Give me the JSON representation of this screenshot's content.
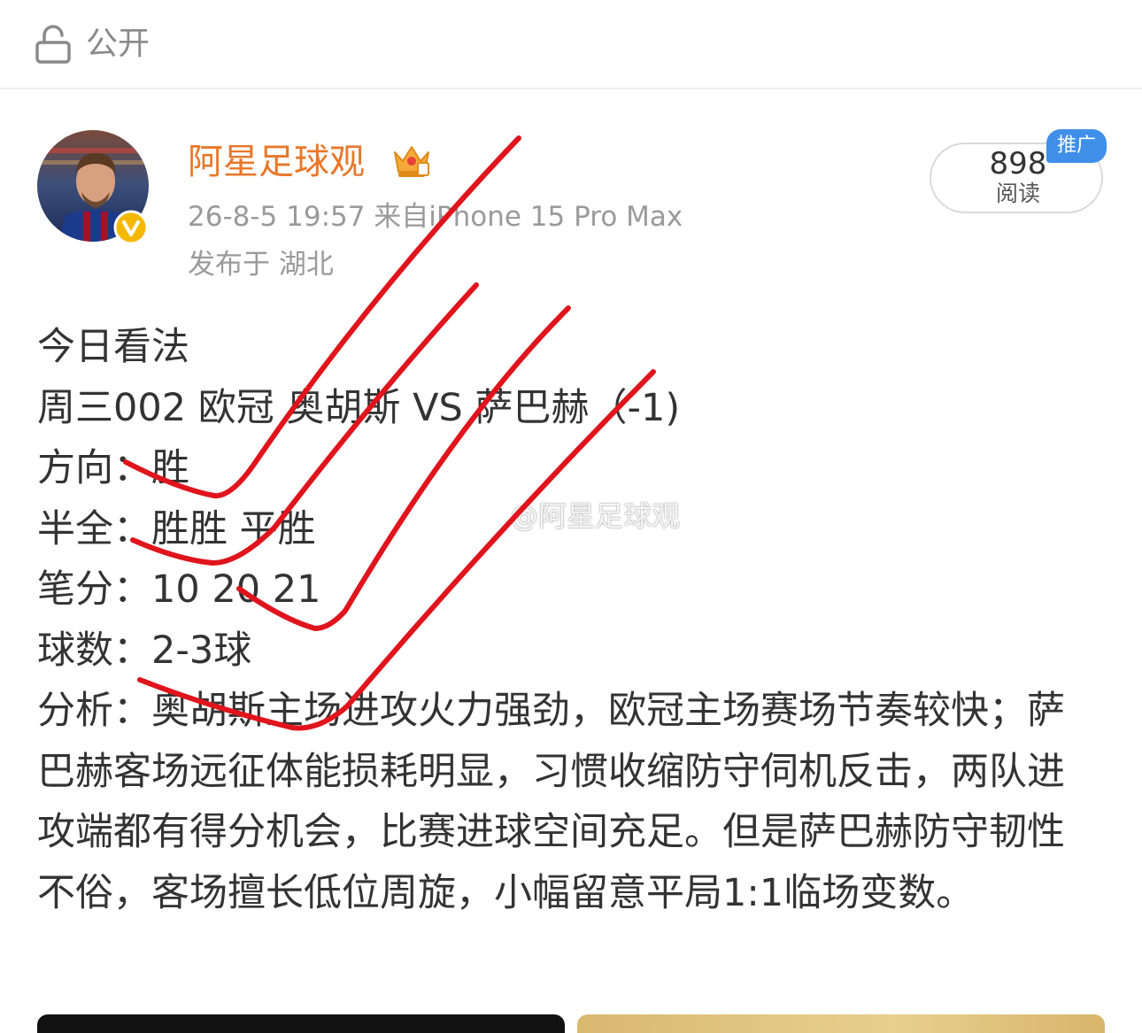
{
  "topbar": {
    "visibility_label": "公开",
    "icon": "lock-icon"
  },
  "post": {
    "author": {
      "name": "阿星足球观",
      "avatar_icon": "avatar",
      "badge_icon": "crown-icon",
      "verified_icon": "verified-badge"
    },
    "meta": "26-8-5 19:57  来自iPhone 15 Pro Max",
    "location": "发布于 湖北",
    "reads": {
      "count": "898",
      "label": "阅读",
      "badge": "推广"
    },
    "lines": [
      "今日看法",
      "周三002 欧冠 奥胡斯 VS 萨巴赫（-1)",
      "方向：胜",
      "半全：胜胜 平胜",
      "笔分：10 20 21",
      "球数：2-3球"
    ],
    "analysis": "分析：奥胡斯主场进攻火力强劲，欧冠主场赛场节奏较快；萨巴赫客场远征体能损耗明显，习惯收缩防守伺机反击，两队进攻端都有得分机会，比赛进球空间充足。但是萨巴赫防守韧性不俗，客场擅长低位周旋，小幅留意平局1:1临场变数。",
    "watermark": "@阿星足球观"
  },
  "colors": {
    "username": "#e8772a",
    "meta": "#9a9a9a",
    "body_text": "#333333",
    "promo_badge": "#3f8fe8",
    "scribble": "#e0141c",
    "verified": "#f5b800"
  }
}
